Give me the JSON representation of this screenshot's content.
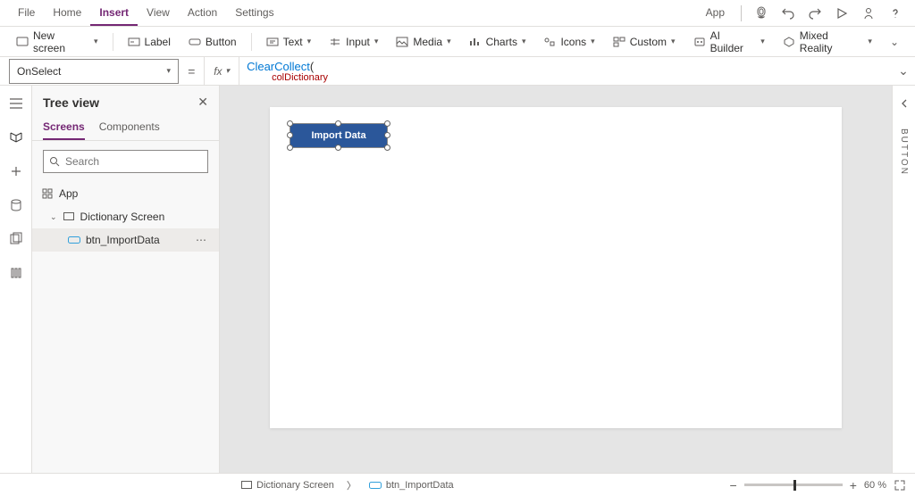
{
  "menu": {
    "file": "File",
    "home": "Home",
    "insert": "Insert",
    "view": "View",
    "action": "Action",
    "settings": "Settings"
  },
  "topright": {
    "app": "App"
  },
  "ribbon": {
    "newscreen": "New screen",
    "label": "Label",
    "button": "Button",
    "text": "Text",
    "input": "Input",
    "media": "Media",
    "charts": "Charts",
    "icons": "Icons",
    "custom": "Custom",
    "aibuilder": "AI Builder",
    "mixed": "Mixed Reality"
  },
  "formula": {
    "property": "OnSelect",
    "fx": "fx",
    "funcName": "ClearCollect",
    "punc": "(",
    "line2": "colDictionary"
  },
  "tree": {
    "title": "Tree view",
    "tabs": {
      "screens": "Screens",
      "components": "Components"
    },
    "searchPlaceholder": "Search",
    "appLabel": "App",
    "screenName": "Dictionary Screen",
    "controlName": "btn_ImportData"
  },
  "canvas": {
    "buttonText": "Import Data"
  },
  "rightRail": {
    "label": "BUTTON"
  },
  "status": {
    "crumb1": "Dictionary Screen",
    "crumb2": "btn_ImportData",
    "zoomValue": "60",
    "zoomUnit": "%"
  }
}
